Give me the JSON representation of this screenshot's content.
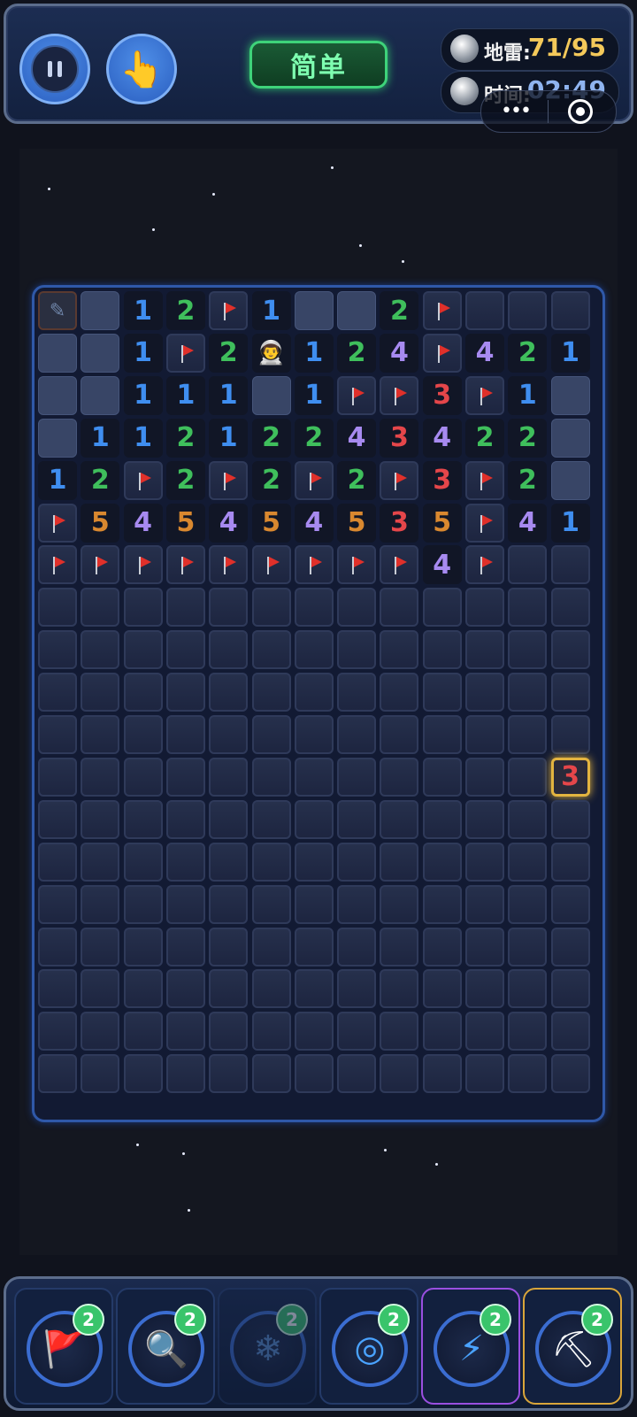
{
  "header": {
    "difficulty": "简单",
    "mines_label": "地雷:",
    "mines_value": "71/95",
    "time_label": "时间:",
    "time_value": "02:49"
  },
  "board": {
    "cols": 13,
    "rows": 19,
    "grid": [
      [
        "P",
        "E",
        "1",
        "2",
        "F",
        "1",
        "E",
        "E",
        "2",
        "F",
        "H",
        "H",
        "H"
      ],
      [
        "E",
        "E",
        "1",
        "F",
        "2",
        "A",
        "1",
        "2",
        "4",
        "F",
        "4",
        "2",
        "1"
      ],
      [
        "E",
        "E",
        "1",
        "1",
        "1",
        "E",
        "1",
        "F",
        "F",
        "3",
        "F",
        "1",
        "E"
      ],
      [
        "E",
        "1",
        "1",
        "2",
        "1",
        "2",
        "2",
        "4",
        "3",
        "4",
        "2",
        "2",
        "E"
      ],
      [
        "1",
        "2",
        "F",
        "2",
        "F",
        "2",
        "F",
        "2",
        "F",
        "3",
        "F",
        "2",
        "E"
      ],
      [
        "F",
        "5",
        "4",
        "5",
        "4",
        "5",
        "4",
        "5",
        "3",
        "5",
        "F",
        "4",
        "1"
      ],
      [
        "F",
        "F",
        "F",
        "F",
        "F",
        "F",
        "F",
        "F",
        "F",
        "4",
        "F",
        "H",
        "H"
      ],
      [
        "H",
        "H",
        "H",
        "H",
        "H",
        "H",
        "H",
        "H",
        "H",
        "H",
        "H",
        "H",
        "H"
      ],
      [
        "H",
        "H",
        "H",
        "H",
        "H",
        "H",
        "H",
        "H",
        "H",
        "H",
        "H",
        "H",
        "H"
      ],
      [
        "H",
        "H",
        "H",
        "H",
        "H",
        "H",
        "H",
        "H",
        "H",
        "H",
        "H",
        "H",
        "H"
      ],
      [
        "H",
        "H",
        "H",
        "H",
        "H",
        "H",
        "H",
        "H",
        "H",
        "H",
        "H",
        "H",
        "H"
      ],
      [
        "H",
        "H",
        "H",
        "H",
        "H",
        "H",
        "H",
        "H",
        "H",
        "H",
        "H",
        "H",
        "X3"
      ],
      [
        "H",
        "H",
        "H",
        "H",
        "H",
        "H",
        "H",
        "H",
        "H",
        "H",
        "H",
        "H",
        "H"
      ],
      [
        "H",
        "H",
        "H",
        "H",
        "H",
        "H",
        "H",
        "H",
        "H",
        "H",
        "H",
        "H",
        "H"
      ],
      [
        "H",
        "H",
        "H",
        "H",
        "H",
        "H",
        "H",
        "H",
        "H",
        "H",
        "H",
        "H",
        "H"
      ],
      [
        "H",
        "H",
        "H",
        "H",
        "H",
        "H",
        "H",
        "H",
        "H",
        "H",
        "H",
        "H",
        "H"
      ],
      [
        "H",
        "H",
        "H",
        "H",
        "H",
        "H",
        "H",
        "H",
        "H",
        "H",
        "H",
        "H",
        "H"
      ],
      [
        "H",
        "H",
        "H",
        "H",
        "H",
        "H",
        "H",
        "H",
        "H",
        "H",
        "H",
        "H",
        "H"
      ],
      [
        "H",
        "H",
        "H",
        "H",
        "H",
        "H",
        "H",
        "H",
        "H",
        "H",
        "H",
        "H",
        "H"
      ]
    ],
    "number_colors": {
      "1": "#3f8ef0",
      "2": "#3fbf5c",
      "3": "#e5464a",
      "4": "#a78af0",
      "5": "#d9882f"
    }
  },
  "tools": [
    {
      "name": "flag-tool",
      "icon": "🚩",
      "count": "2",
      "state": "normal"
    },
    {
      "name": "magnifier-tool",
      "icon": "🔍",
      "count": "2",
      "state": "normal"
    },
    {
      "name": "freeze-tool",
      "icon": "❄",
      "count": "2",
      "state": "disabled"
    },
    {
      "name": "target-tool",
      "icon": "◎",
      "count": "2",
      "state": "normal"
    },
    {
      "name": "lightning-tool",
      "icon": "⚡",
      "count": "2",
      "state": "purple"
    },
    {
      "name": "shovel-tool",
      "icon": "⛏",
      "count": "2",
      "state": "gold"
    }
  ]
}
